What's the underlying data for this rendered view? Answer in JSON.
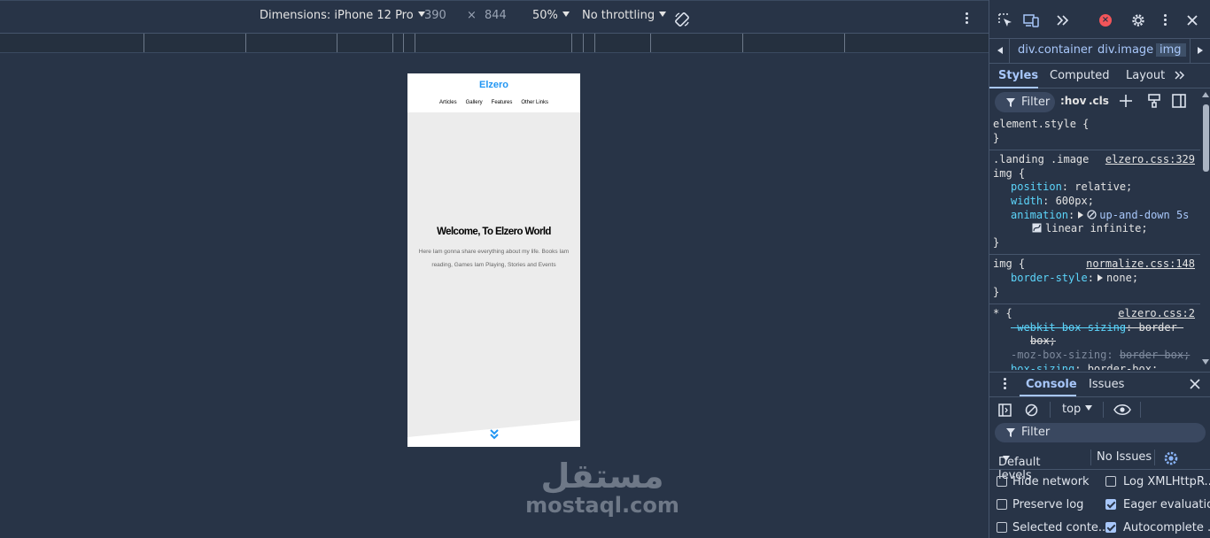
{
  "device_toolbar": {
    "dimensions_label": "Dimensions: iPhone 12 Pro",
    "width": "390",
    "times": "×",
    "height": "844",
    "zoom": "50%",
    "throttling": "No throttling"
  },
  "site": {
    "logo": "Elzero",
    "nav": [
      "Articles",
      "Gallery",
      "Features",
      "Other Links"
    ],
    "landing_title": "Welcome, To Elzero World",
    "landing_text": "Here Iam gonna share everything about my life. Books Iam reading, Games Iam Playing, Stories and Events"
  },
  "watermark": {
    "arabic": "مستقل",
    "latin": "mostaql.com"
  },
  "devtools": {
    "breadcrumbs": [
      "div.container",
      "div.image",
      "img"
    ],
    "subtabs": [
      "Styles",
      "Computed",
      "Layout"
    ],
    "filter_placeholder": "Filter",
    "hov": ":hov",
    "cls": ".cls",
    "rules": {
      "r1": {
        "selector": "element.style {",
        "close": "}"
      },
      "r2": {
        "selector1": ".landing .image",
        "selector2": "img {",
        "source": "elzero.css:329",
        "p1k": "position",
        "p1v": "relative;",
        "p2k": "width",
        "p2v": "600px;",
        "p3k": "animation",
        "p3v": "up-and-down 5s",
        "p3v2": "linear infinite;",
        "close": "}"
      },
      "r3": {
        "selector": "img {",
        "source": "normalize.css:148",
        "p1k": "border-style",
        "p1v": "none;",
        "close": "}"
      },
      "r4": {
        "selector": "* {",
        "source": "elzero.css:2",
        "p1k": "-webkit-box-sizing",
        "p1v": "border-",
        "p1v2": "box;",
        "p2k": "-moz-box-sizing",
        "p2v": "border-box;",
        "p3k": "box-sizing",
        "p3v": "border-box;"
      }
    },
    "drawer_tabs": [
      "Console",
      "Issues"
    ],
    "console_context": "top",
    "console_filter": "Filter",
    "default_levels": "Default levels",
    "no_issues": "No Issues",
    "options": [
      {
        "label": "Hide network",
        "checked": false
      },
      {
        "label": "Log XMLHttpR...",
        "checked": false
      },
      {
        "label": "Preserve log",
        "checked": false
      },
      {
        "label": "Eager evaluation",
        "checked": true
      },
      {
        "label": "Selected conte...",
        "checked": false
      },
      {
        "label": "Autocomplete ...",
        "checked": true
      }
    ]
  },
  "colors": {
    "accent": "#a8c7fa",
    "brand": "#2196f3",
    "error": "#f2555a",
    "background": "#283447"
  }
}
